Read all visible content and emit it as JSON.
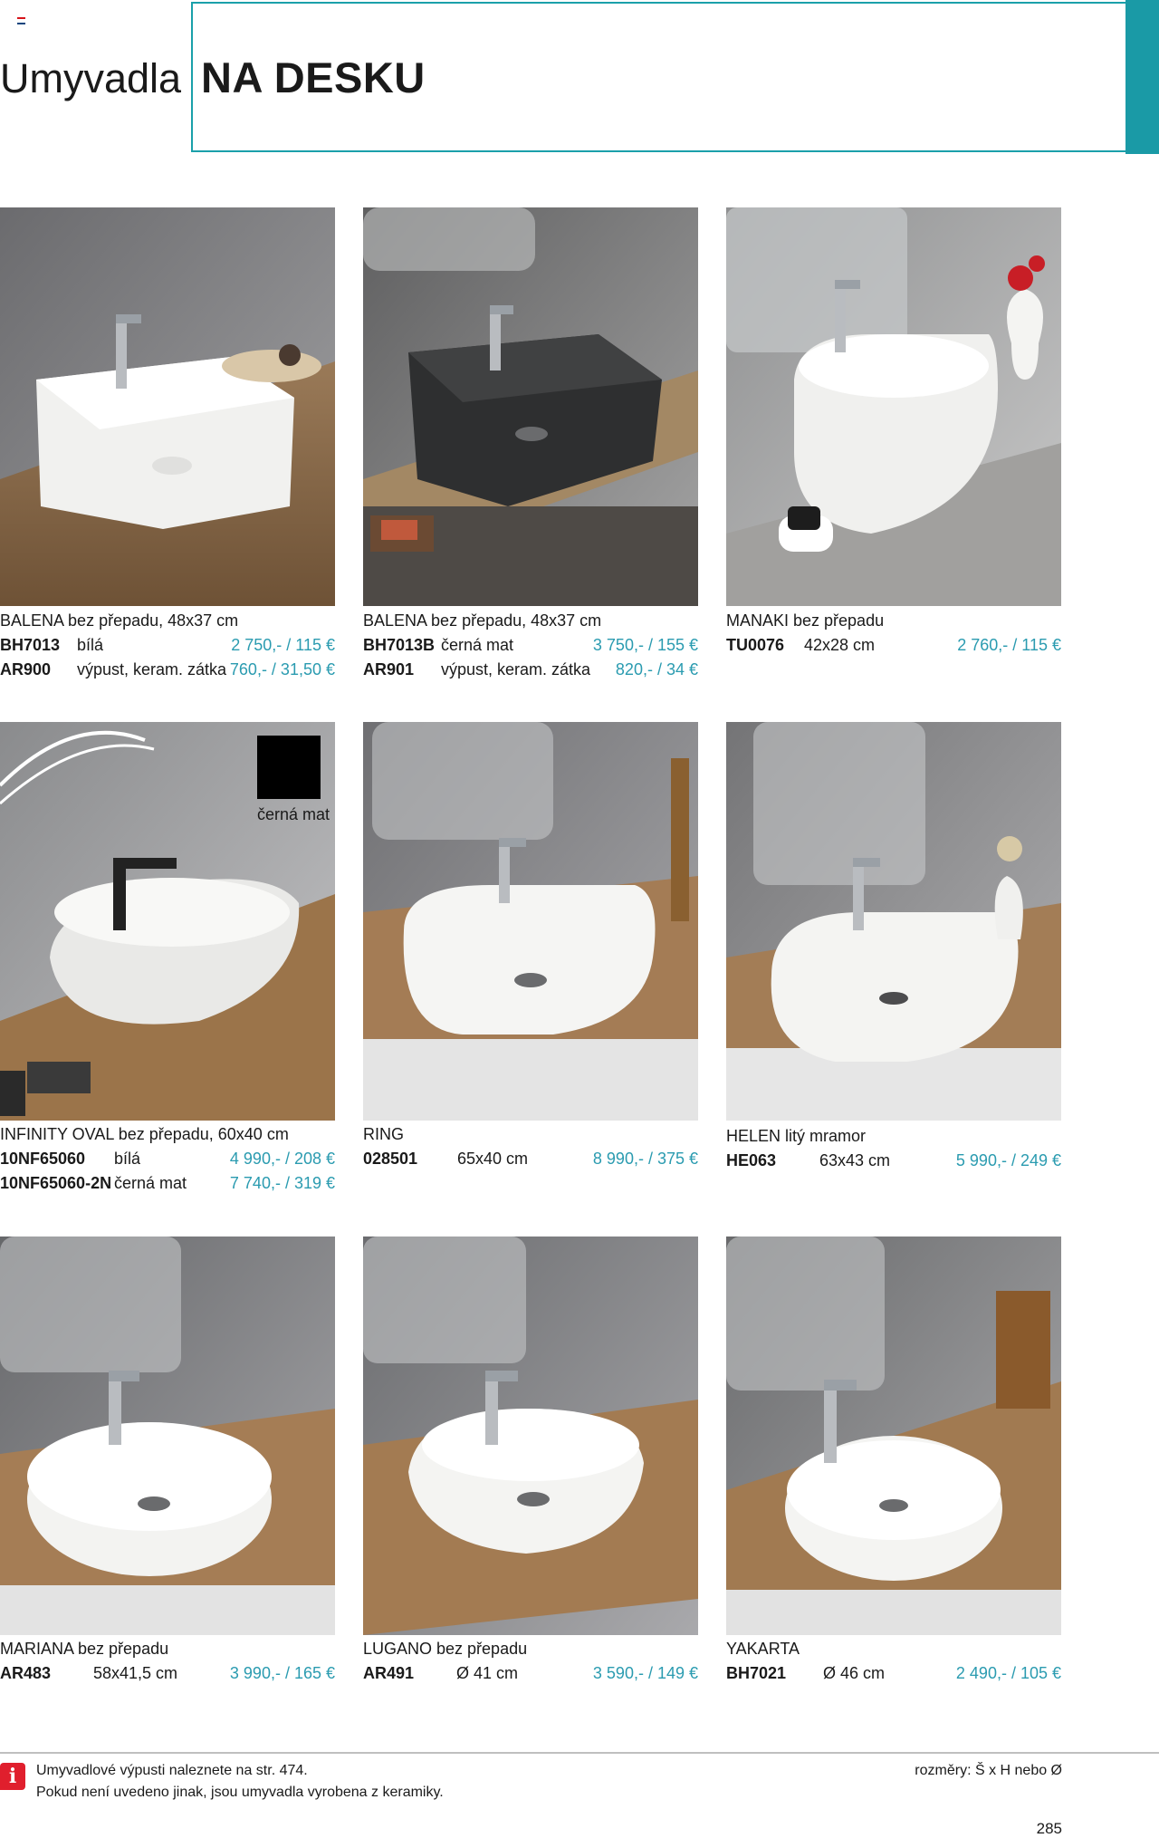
{
  "header": {
    "title": "Umyvadla",
    "subtitle": "NA DESKU",
    "accent_color": "#1a9aa6"
  },
  "products": [
    {
      "name": "BALENA bez přepadu, 48x37 cm",
      "rows": [
        {
          "code": "BH7013",
          "desc": "bílá",
          "price": "2 750,- / 115 €"
        },
        {
          "code": "AR900",
          "desc": "výpust, keram. zátka",
          "price": "760,- / 31,50 €"
        }
      ],
      "basin_color": "white"
    },
    {
      "name": "BALENA bez přepadu, 48x37 cm",
      "rows": [
        {
          "code": "BH7013B",
          "desc": "černá mat",
          "price": "3 750,- / 155 €"
        },
        {
          "code": "AR901",
          "desc": "výpust, keram. zátka",
          "price": "820,- / 34 €"
        }
      ],
      "basin_color": "black"
    },
    {
      "name": "MANAKI bez přepadu",
      "rows": [
        {
          "code": "TU0076",
          "desc": "42x28 cm",
          "price": "2 760,- / 115 €"
        }
      ],
      "basin_color": "white"
    },
    {
      "name": "INFINITY OVAL bez přepadu, 60x40 cm",
      "rows": [
        {
          "code": "10NF65060",
          "desc": "bílá",
          "price": "4 990,- / 208 €"
        },
        {
          "code": "10NF65060-2N",
          "desc": "černá mat",
          "price": "7 740,- / 319 €"
        }
      ],
      "basin_color": "white"
    },
    {
      "name": "RING",
      "rows": [
        {
          "code": "028501",
          "desc": "65x40 cm",
          "price": "8 990,- / 375 €"
        }
      ],
      "basin_color": "white"
    },
    {
      "name": "HELEN litý mramor",
      "rows": [
        {
          "code": "HE063",
          "desc": "63x43 cm",
          "price": "5 990,- / 249 €"
        }
      ],
      "basin_color": "white"
    },
    {
      "name": "MARIANA bez přepadu",
      "rows": [
        {
          "code": "AR483",
          "desc": "58x41,5 cm",
          "price": "3 990,- / 165 €"
        }
      ],
      "basin_color": "white"
    },
    {
      "name": "LUGANO bez přepadu",
      "rows": [
        {
          "code": "AR491",
          "desc": "Ø 41 cm",
          "price": "3 590,- / 149 €"
        }
      ],
      "basin_color": "white"
    },
    {
      "name": "YAKARTA",
      "rows": [
        {
          "code": "BH7021",
          "desc": "Ø 46 cm",
          "price": "2 490,- / 105 €"
        }
      ],
      "basin_color": "white"
    }
  ],
  "swatch": {
    "label": "černá mat",
    "color": "#000000"
  },
  "footer": {
    "note_1": "Umyvadlové výpusti naleznete na str. 474.",
    "note_2": "Pokud není uvedeno jinak, jsou umyvadla vyrobena z keramiky.",
    "legend": "rozměry: Š x H nebo Ø",
    "page_number": "285"
  },
  "price_color": "#2a9bb0"
}
